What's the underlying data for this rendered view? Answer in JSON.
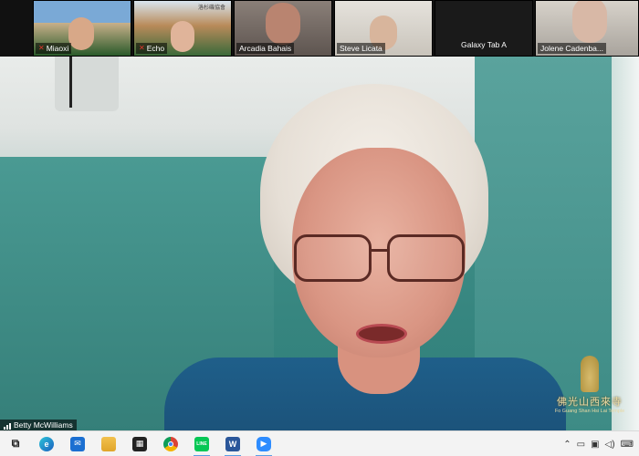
{
  "participants": [
    {
      "name": "Miaoxi",
      "muted": true
    },
    {
      "name": "Echo",
      "muted": true
    },
    {
      "name": "Arcadia Bahais",
      "muted": false
    },
    {
      "name": "Steve Licata",
      "muted": false
    },
    {
      "name": "Galaxy Tab A",
      "muted": false
    },
    {
      "name": "Jolene Cadenba...",
      "muted": false
    }
  ],
  "thumb_banner": "洛杉磯協會",
  "active_speaker": "Betty McWilliams",
  "watermark": {
    "title": "佛光山西來寺",
    "subtitle": "Fo Guang Shan Hsi Lai Temple"
  },
  "taskbar": {
    "apps": [
      {
        "icon": "task-view-icon",
        "glyph": "⧉"
      },
      {
        "icon": "edge-icon",
        "glyph": "e"
      },
      {
        "icon": "mail-icon",
        "glyph": "✉"
      },
      {
        "icon": "file-explorer-icon",
        "glyph": "▬"
      },
      {
        "icon": "store-icon",
        "glyph": "▦"
      },
      {
        "icon": "chrome-icon",
        "glyph": "◉"
      },
      {
        "icon": "line-icon",
        "glyph": "LINE"
      },
      {
        "icon": "word-icon",
        "glyph": "W"
      },
      {
        "icon": "zoom-icon",
        "glyph": "▶"
      }
    ],
    "tray": [
      "^",
      "▭",
      "▣",
      "🔊",
      "⌨"
    ]
  },
  "colors": {
    "mute": "#e0362b",
    "taskbar": "#f3f3f3",
    "accent": "#5aa0e6"
  }
}
